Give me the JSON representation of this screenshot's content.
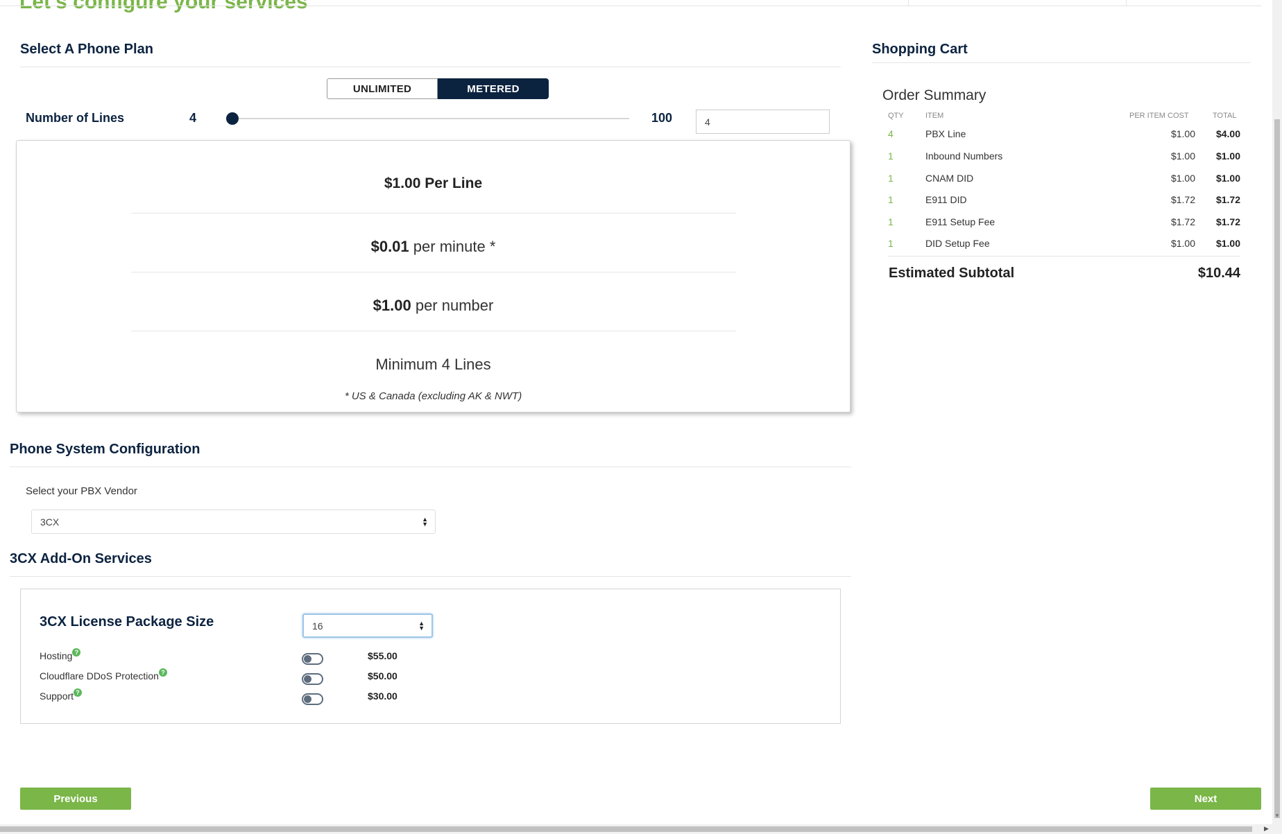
{
  "header": {
    "title": "Let's configure your services"
  },
  "plan": {
    "section_title": "Select A Phone Plan",
    "options": [
      {
        "label": "UNLIMITED",
        "selected": false
      },
      {
        "label": "METERED",
        "selected": true
      }
    ],
    "lines": {
      "label": "Number of Lines",
      "min": "4",
      "max": "100",
      "value": "4",
      "slider_fraction": 0.0
    },
    "details": {
      "per_line_price": "$1.00",
      "per_line_text": "Per Line",
      "per_minute_price": "$0.01",
      "per_minute_text": "per minute *",
      "per_number_price": "$1.00",
      "per_number_text": "per number",
      "minimum": "Minimum 4 Lines",
      "footnote": "* US & Canada (excluding AK & NWT)"
    }
  },
  "phone_system": {
    "section_title": "Phone System Configuration",
    "vendor_label": "Select your PBX Vendor",
    "vendor_value": "3CX"
  },
  "addons": {
    "section_title": "3CX Add-On Services",
    "license_label": "3CX License Package Size",
    "license_value": "16",
    "help_glyph": "?",
    "items": [
      {
        "label": "Hosting",
        "price": "$55.00",
        "enabled": false
      },
      {
        "label": "Cloudflare DDoS Protection",
        "price": "$50.00",
        "enabled": false
      },
      {
        "label": "Support",
        "price": "$30.00",
        "enabled": false
      }
    ]
  },
  "nav": {
    "previous_label": "Previous",
    "next_label": "Next"
  },
  "cart": {
    "title": "Shopping Cart",
    "summary_title": "Order Summary",
    "columns": {
      "qty": "QTY",
      "item": "ITEM",
      "per": "PER ITEM COST",
      "total": "TOTAL"
    },
    "rows": [
      {
        "qty": "4",
        "item": "PBX Line",
        "per": "$1.00",
        "total": "$4.00"
      },
      {
        "qty": "1",
        "item": "Inbound Numbers",
        "per": "$1.00",
        "total": "$1.00"
      },
      {
        "qty": "1",
        "item": "CNAM DID",
        "per": "$1.00",
        "total": "$1.00"
      },
      {
        "qty": "1",
        "item": "E911 DID",
        "per": "$1.72",
        "total": "$1.72"
      },
      {
        "qty": "1",
        "item": "E911 Setup Fee",
        "per": "$1.72",
        "total": "$1.72"
      },
      {
        "qty": "1",
        "item": "DID Setup Fee",
        "per": "$1.00",
        "total": "$1.00"
      }
    ],
    "subtotal_label": "Estimated Subtotal",
    "subtotal_value": "$10.44"
  },
  "colors": {
    "navy": "#0c2340",
    "green": "#7ab648",
    "help_green": "#5cb85c"
  }
}
